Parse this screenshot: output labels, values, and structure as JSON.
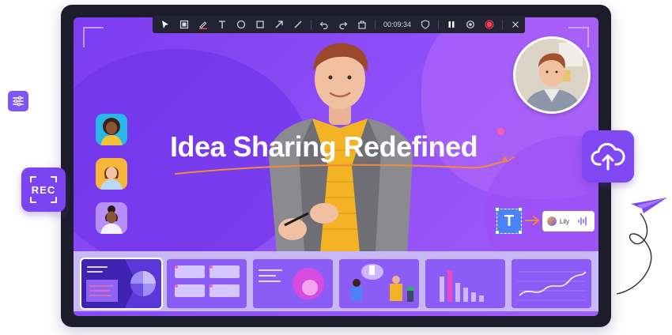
{
  "toolbar": {
    "timer": "00:09:34",
    "tools": [
      "select",
      "crop",
      "pen",
      "text",
      "circle",
      "rectangle",
      "arrow",
      "line",
      "undo",
      "redo",
      "clear",
      "timer",
      "shield",
      "pause",
      "loop",
      "record",
      "close"
    ]
  },
  "slide": {
    "title": "Idea Sharing Redefined"
  },
  "widgets": {
    "text_icon": "T",
    "voice_name": "Lily"
  },
  "side_icons": {
    "rec_label": "REC"
  },
  "colors": {
    "accent": "#7c3cf0",
    "record": "#ff3d57",
    "toolbar_bg": "#242333",
    "pink_dot": "#ff5fa8",
    "orange": "#f28a3b"
  }
}
